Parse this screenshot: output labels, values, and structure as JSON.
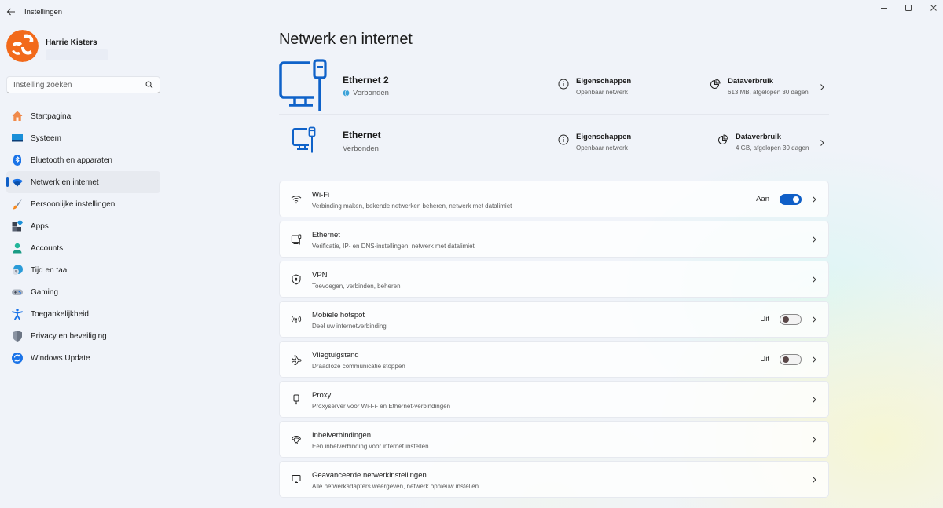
{
  "window": {
    "title": "Instellingen",
    "controls": [
      "minimize",
      "maximize",
      "close"
    ]
  },
  "user": {
    "name": "Harrie Kisters"
  },
  "search": {
    "placeholder": "Instelling zoeken",
    "value": ""
  },
  "sidebar": {
    "items": [
      {
        "label": "Startpagina",
        "icon": "home-icon",
        "active": false
      },
      {
        "label": "Systeem",
        "icon": "system-icon",
        "active": false
      },
      {
        "label": "Bluetooth en apparaten",
        "icon": "bluetooth-icon",
        "active": false
      },
      {
        "label": "Netwerk en internet",
        "icon": "wifi-icon",
        "active": true
      },
      {
        "label": "Persoonlijke instellingen",
        "icon": "brush-icon",
        "active": false
      },
      {
        "label": "Apps",
        "icon": "apps-icon",
        "active": false
      },
      {
        "label": "Accounts",
        "icon": "account-icon",
        "active": false
      },
      {
        "label": "Tijd en taal",
        "icon": "time-language-icon",
        "active": false
      },
      {
        "label": "Gaming",
        "icon": "gamepad-icon",
        "active": false
      },
      {
        "label": "Toegankelijkheid",
        "icon": "accessibility-icon",
        "active": false
      },
      {
        "label": "Privacy en beveiliging",
        "icon": "shield-icon",
        "active": false
      },
      {
        "label": "Windows Update",
        "icon": "update-icon",
        "active": false
      }
    ]
  },
  "main": {
    "title": "Netwerk en internet",
    "connections": [
      {
        "name": "Ethernet 2",
        "status": "Verbonden",
        "properties_label": "Eigenschappen",
        "properties_sub": "Openbaar netwerk",
        "data_label": "Dataverbruik",
        "data_sub": "613 MB, afgelopen 30 dagen"
      },
      {
        "name": "Ethernet",
        "status": "Verbonden",
        "properties_label": "Eigenschappen",
        "properties_sub": "Openbaar netwerk",
        "data_label": "Dataverbruik",
        "data_sub": "4 GB, afgelopen 30 dagen"
      }
    ],
    "cards": [
      {
        "title": "Wi-Fi",
        "subtitle": "Verbinding maken, bekende netwerken beheren, netwerk met datalimiet",
        "icon": "wifi-icon",
        "toggle": true,
        "toggle_label": "Aan"
      },
      {
        "title": "Ethernet",
        "subtitle": "Verificatie, IP- en DNS-instellingen, netwerk met datalimiet",
        "icon": "ethernet-icon"
      },
      {
        "title": "VPN",
        "subtitle": "Toevoegen, verbinden, beheren",
        "icon": "vpn-shield-icon"
      },
      {
        "title": "Mobiele hotspot",
        "subtitle": "Deel uw internetverbinding",
        "icon": "hotspot-icon",
        "toggle": false,
        "toggle_label": "Uit"
      },
      {
        "title": "Vliegtuigstand",
        "subtitle": "Draadloze communicatie stoppen",
        "icon": "airplane-icon",
        "toggle": false,
        "toggle_label": "Uit"
      },
      {
        "title": "Proxy",
        "subtitle": "Proxyserver voor Wi-Fi- en Ethernet-verbindingen",
        "icon": "proxy-icon"
      },
      {
        "title": "Inbelverbindingen",
        "subtitle": "Een inbelverbinding voor internet instellen",
        "icon": "dialup-icon"
      },
      {
        "title": "Geavanceerde netwerkinstellingen",
        "subtitle": "Alle netwerkadapters weergeven, netwerk opnieuw instellen",
        "icon": "network-adapter-icon"
      }
    ]
  },
  "colors": {
    "accent": "#0f5fc7",
    "background": "#f0f3f9",
    "avatar": "#f26a1b"
  }
}
